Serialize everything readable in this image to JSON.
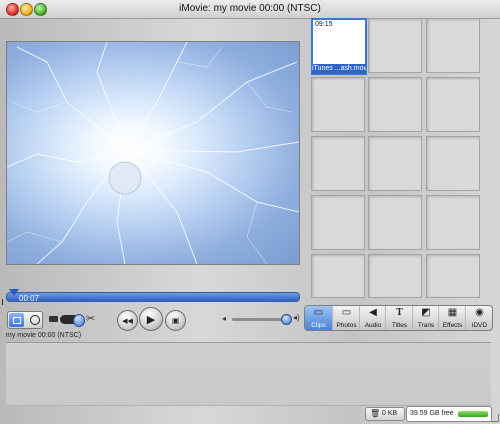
{
  "window": {
    "title": "iMovie: my movie  00:00 (NTSC)"
  },
  "viewer": {
    "playhead_time": "00:07"
  },
  "clips_pane": {
    "clips": [
      {
        "duration": "09:15",
        "name": "iTunes ...ash.mov"
      }
    ],
    "empty_slots": 14
  },
  "controls": {
    "camera_mode_icon": "camera-icon",
    "edit_mode_icon": "clock-icon",
    "scissors_icon": "scissors-icon",
    "rewind_icon": "rewind-icon",
    "play_icon": "play-icon",
    "fullscreen_play_icon": "fullscreen-play-icon",
    "volume_icon": "speaker-icon"
  },
  "panel_buttons": [
    {
      "label": "Clips",
      "icon": "clips-icon",
      "active": true
    },
    {
      "label": "Photos",
      "icon": "photos-icon",
      "active": false
    },
    {
      "label": "Audio",
      "icon": "audio-icon",
      "active": false
    },
    {
      "label": "Titles",
      "icon": "titles-icon",
      "active": false
    },
    {
      "label": "Trans",
      "icon": "transitions-icon",
      "active": false
    },
    {
      "label": "Effects",
      "icon": "effects-icon",
      "active": false
    },
    {
      "label": "iDVD",
      "icon": "idvd-icon",
      "active": false
    }
  ],
  "timeline": {
    "project_label": "my movie  00:00 (NTSC)"
  },
  "status": {
    "trash_size": "0 KB",
    "disk_free": "39.59 GB free"
  },
  "colors": {
    "accent": "#2f64c8",
    "free_bar": "#39a41b"
  }
}
